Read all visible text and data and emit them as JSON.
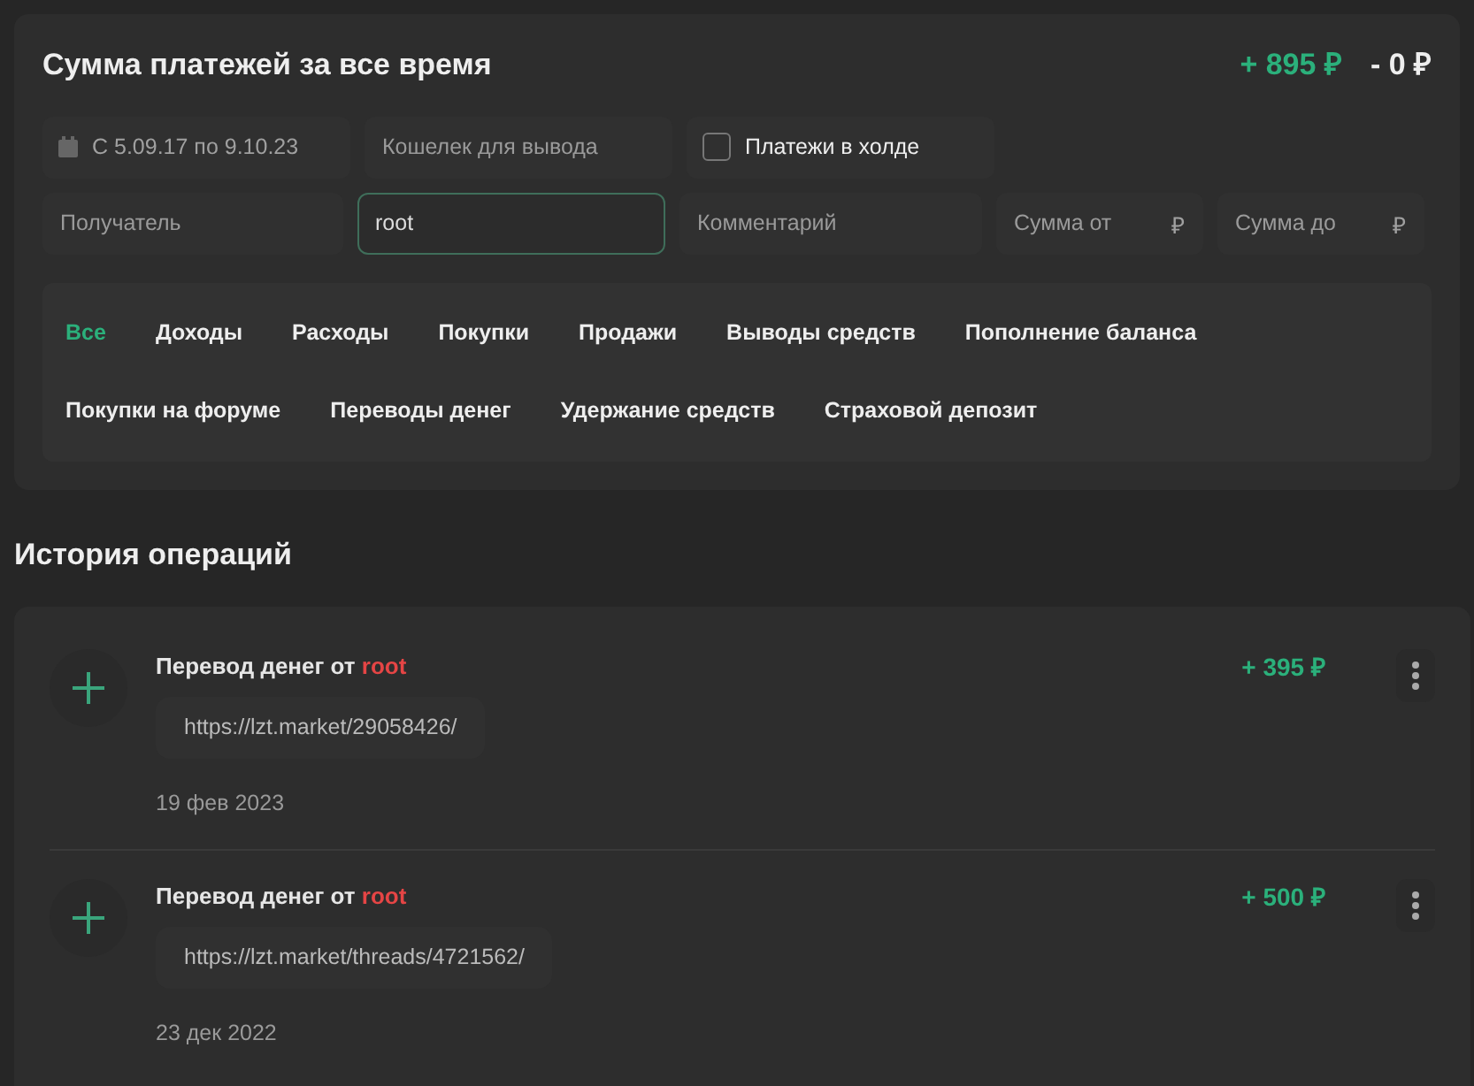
{
  "summary": {
    "title": "Сумма платежей за все время",
    "income": "+ 895 ₽",
    "expense": "- 0 ₽"
  },
  "filters": {
    "date_range": "С 5.09.17 по 9.10.23",
    "wallet": {
      "placeholder": "Кошелек для вывода"
    },
    "hold": {
      "label": "Платежи в холде",
      "checked": false
    },
    "recipient": {
      "placeholder": "Получатель"
    },
    "user": {
      "value": "root",
      "focused": true
    },
    "comment": {
      "placeholder": "Комментарий"
    },
    "sum_from": {
      "placeholder": "Сумма от",
      "currency": "₽"
    },
    "sum_to": {
      "placeholder": "Сумма до",
      "currency": "₽"
    }
  },
  "tabs": [
    {
      "label": "Все",
      "selected": true
    },
    {
      "label": "Доходы",
      "selected": false
    },
    {
      "label": "Расходы",
      "selected": false
    },
    {
      "label": "Покупки",
      "selected": false
    },
    {
      "label": "Продажи",
      "selected": false
    },
    {
      "label": "Выводы средств",
      "selected": false
    },
    {
      "label": "Пополнение баланса",
      "selected": false
    },
    {
      "label": "Покупки на форуме",
      "selected": false
    },
    {
      "label": "Переводы денег",
      "selected": false
    },
    {
      "label": "Удержание средств",
      "selected": false
    },
    {
      "label": "Страховой депозит",
      "selected": false
    }
  ],
  "history": {
    "title": "История операций",
    "operations": [
      {
        "kind": "income",
        "title": "Перевод денег от",
        "user": "root",
        "link": "https://lzt.market/29058426/",
        "date": "19 фев 2023",
        "amount": "+ 395 ₽"
      },
      {
        "kind": "income",
        "title": "Перевод денег от",
        "user": "root",
        "link": "https://lzt.market/threads/4721562/",
        "date": "23 дек 2022",
        "amount": "+ 500 ₽"
      }
    ]
  }
}
